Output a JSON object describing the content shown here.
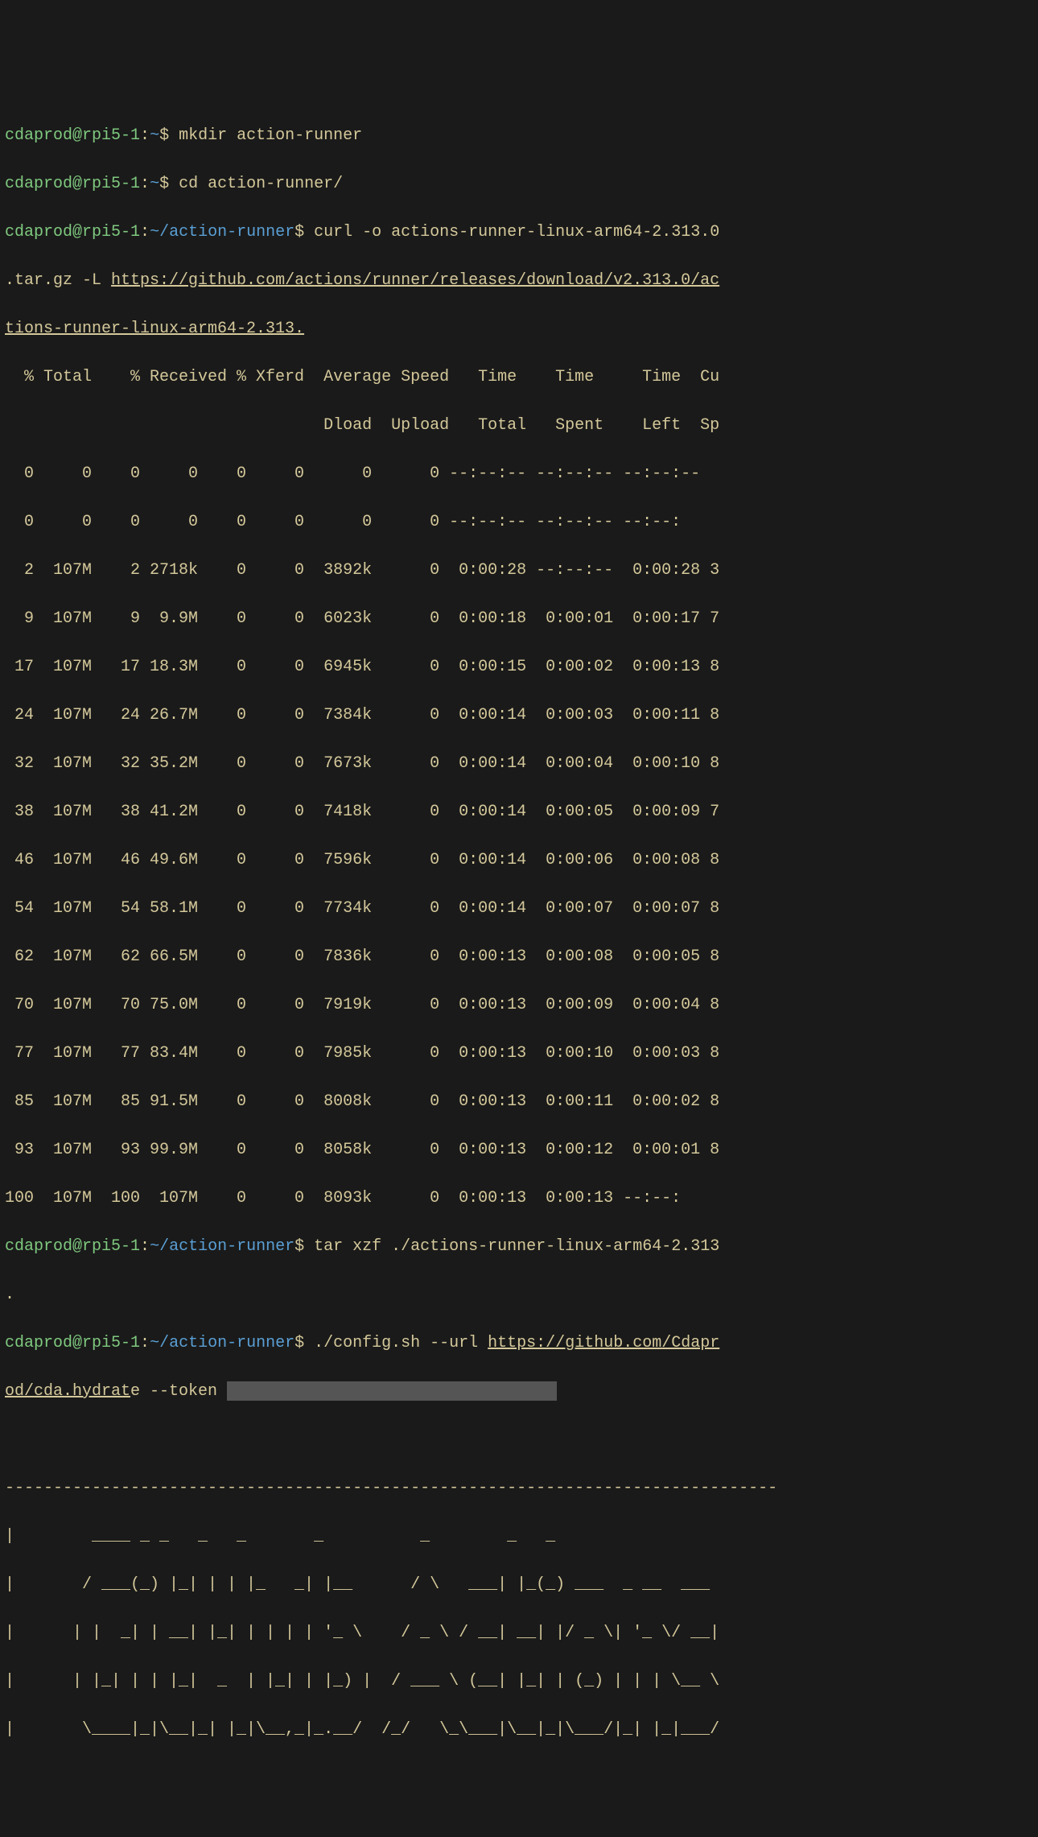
{
  "user": "cdaprod",
  "host": "rpi5-1",
  "prompts": {
    "home": "~",
    "runner_dir": "~/action-runner",
    "dollar": "$"
  },
  "commands": {
    "mkdir": "mkdir action-runner",
    "cd": "cd action-runner/",
    "curl_pre": "curl -o actions-runner-linux-arm64-2.313.0",
    "curl_line2a": ".tar.gz -L ",
    "curl_url_part1": "https://github.com/actions/runner/releases/download/v2.313.0/ac",
    "curl_url_part2": "tions-runner-linux-arm64-2.313.",
    "tar": "tar xzf ./actions-runner-linux-arm64-2.313",
    "tar_dot": ".",
    "config_pre": "./config.sh --url ",
    "config_url": "https://github.com/Cdapr",
    "config_url2": "od/cda.hydrat",
    "config_after": "e --token "
  },
  "curl_header1": "  % Total    % Received % Xferd  Average Speed   Time    Time     Time  Cu",
  "curl_header2": "                                 Dload  Upload   Total   Spent    Left  Sp",
  "rows": [
    "  0     0    0     0    0     0      0      0 --:--:-- --:--:-- --:--:--",
    "  0     0    0     0    0     0      0      0 --:--:-- --:--:-- --:--:",
    "  2  107M    2 2718k    0     0  3892k      0  0:00:28 --:--:--  0:00:28 3",
    "  9  107M    9  9.9M    0     0  6023k      0  0:00:18  0:00:01  0:00:17 7",
    " 17  107M   17 18.3M    0     0  6945k      0  0:00:15  0:00:02  0:00:13 8",
    " 24  107M   24 26.7M    0     0  7384k      0  0:00:14  0:00:03  0:00:11 8",
    " 32  107M   32 35.2M    0     0  7673k      0  0:00:14  0:00:04  0:00:10 8",
    " 38  107M   38 41.2M    0     0  7418k      0  0:00:14  0:00:05  0:00:09 7",
    " 46  107M   46 49.6M    0     0  7596k      0  0:00:14  0:00:06  0:00:08 8",
    " 54  107M   54 58.1M    0     0  7734k      0  0:00:14  0:00:07  0:00:07 8",
    " 62  107M   62 66.5M    0     0  7836k      0  0:00:13  0:00:08  0:00:05 8",
    " 70  107M   70 75.0M    0     0  7919k      0  0:00:13  0:00:09  0:00:04 8",
    " 77  107M   77 83.4M    0     0  7985k      0  0:00:13  0:00:10  0:00:03 8",
    " 85  107M   85 91.5M    0     0  8008k      0  0:00:13  0:00:11  0:00:02 8",
    " 93  107M   93 99.9M    0     0  8058k      0  0:00:13  0:00:12  0:00:01 8",
    "100  107M  100  107M    0     0  8093k      0  0:00:13  0:00:13 --:--:"
  ],
  "ascii_art": [
    "--------------------------------------------------------------------------------",
    "|        ____ _ _   _   _       _          _        _   _                      ",
    "|       / ___(_) |_| | | |_   _| |__      / \\   ___| |_(_) ___  _ __  ___      ",
    "|      | |  _| | __| |_| | | | | '_ \\    / _ \\ / __| __| |/ _ \\| '_ \\/ __|     ",
    "|      | |_| | | |_|  _  | |_| | |_) |  / ___ \\ (__| |_| | (_) | | | \\__ \\     ",
    "|       \\____|_|\\__|_| |_|\\__,_|_.__/  /_/   \\_\\___|\\__|_|\\___/|_| |_|___/     "
  ]
}
